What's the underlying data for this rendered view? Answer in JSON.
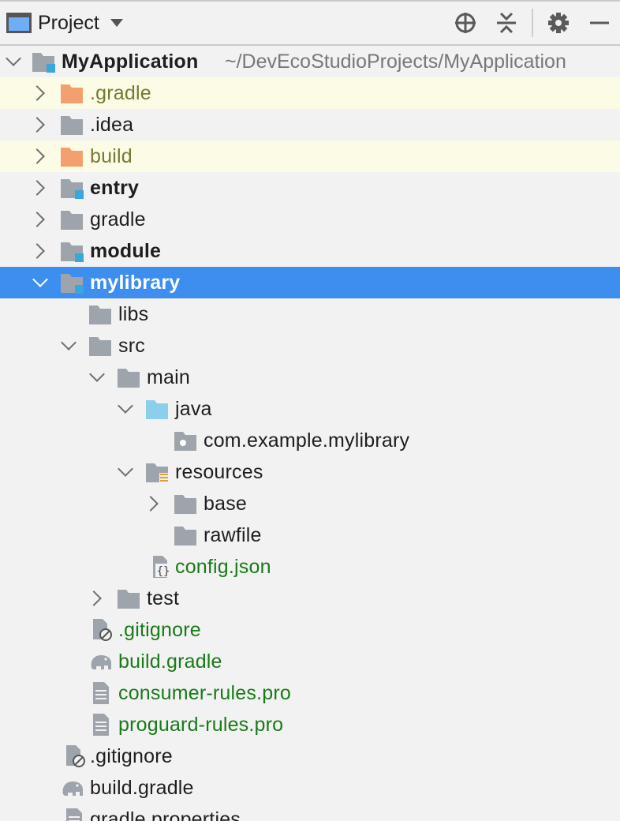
{
  "toolbar": {
    "title": "Project",
    "icons": [
      "project-view-icon",
      "chevron-down-icon",
      "locate-icon",
      "collapse-all-icon",
      "gear-icon",
      "hide-icon"
    ]
  },
  "colors": {
    "selection": "#3d8eef",
    "excluded_highlight": "#fcfbe6",
    "folder_gray": "#9ea4ab",
    "folder_orange": "#f3a070",
    "source_folder_blue": "#8dcfea",
    "module_marker": "#3aa7dc",
    "vcs_added_green": "#187a18",
    "excluded_olive": "#747a32"
  },
  "tree": {
    "root": {
      "label": "MyApplication",
      "path": "~/DevEcoStudioProjects/MyApplication"
    },
    "rows": [
      {
        "label": ".gradle"
      },
      {
        "label": ".idea"
      },
      {
        "label": "build"
      },
      {
        "label": "entry"
      },
      {
        "label": "gradle"
      },
      {
        "label": "module"
      },
      {
        "label": "mylibrary"
      },
      {
        "label": "libs"
      },
      {
        "label": "src"
      },
      {
        "label": "main"
      },
      {
        "label": "java"
      },
      {
        "label": "com.example.mylibrary"
      },
      {
        "label": "resources"
      },
      {
        "label": "base"
      },
      {
        "label": "rawfile"
      },
      {
        "label": "config.json"
      },
      {
        "label": "test"
      },
      {
        "label": ".gitignore"
      },
      {
        "label": "build.gradle"
      },
      {
        "label": "consumer-rules.pro"
      },
      {
        "label": "proguard-rules.pro"
      },
      {
        "label": ".gitignore"
      },
      {
        "label": "build.gradle"
      },
      {
        "label": "gradle.properties"
      }
    ]
  }
}
